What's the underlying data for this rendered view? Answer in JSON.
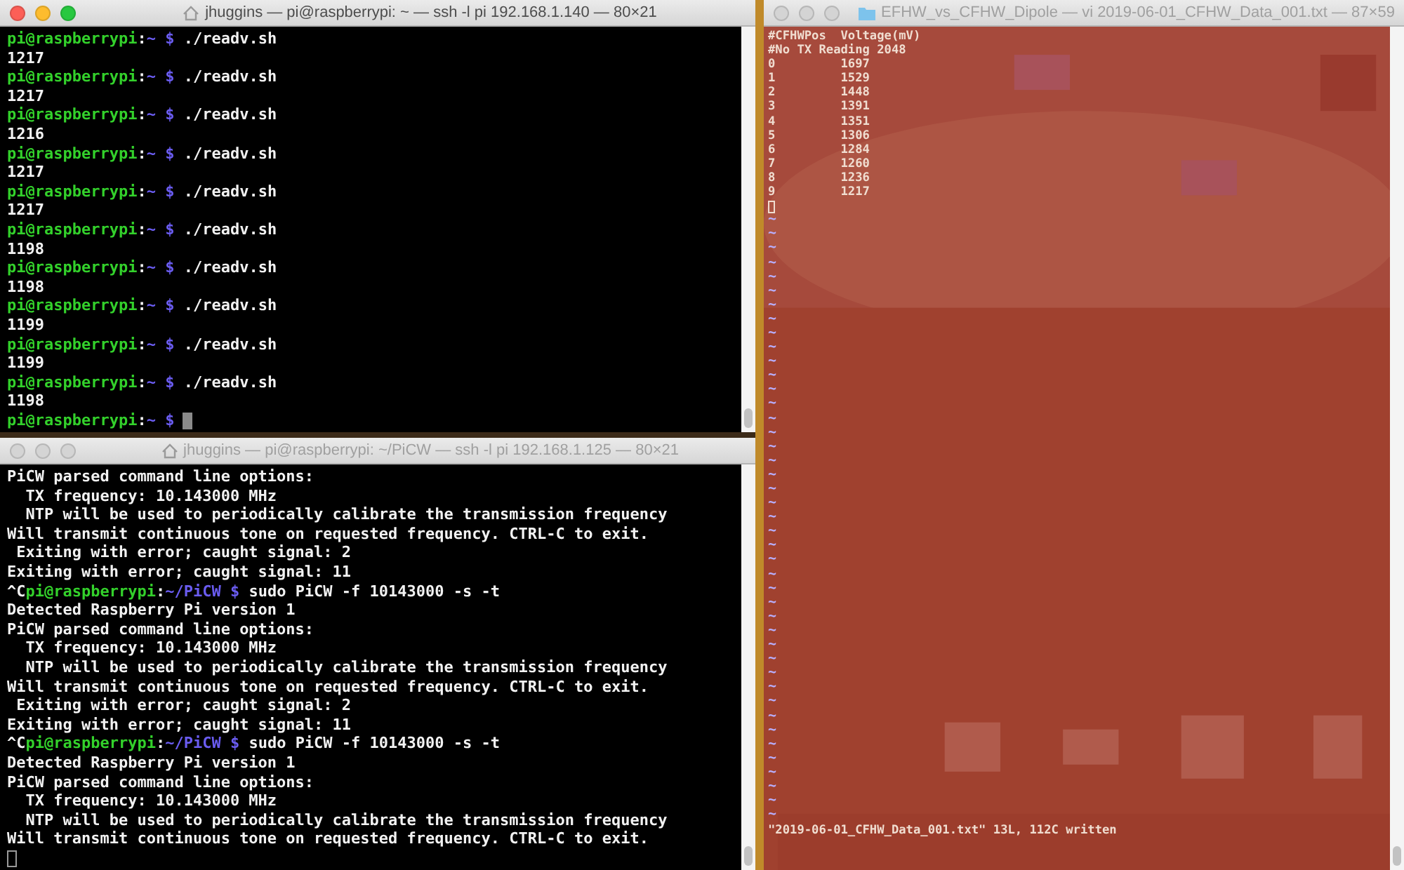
{
  "terminals": [
    {
      "title": "jhuggins — pi@raspberrypi: ~ — ssh -l pi 192.168.1.140 — 80×21",
      "active": true,
      "lines": [
        {
          "kind": "prompt",
          "user": "pi@raspberrypi",
          "sep": ":",
          "path": "~ $",
          "command": "./readv.sh"
        },
        {
          "kind": "output",
          "text": "1217"
        },
        {
          "kind": "prompt",
          "user": "pi@raspberrypi",
          "sep": ":",
          "path": "~ $",
          "command": "./readv.sh"
        },
        {
          "kind": "output",
          "text": "1217"
        },
        {
          "kind": "prompt",
          "user": "pi@raspberrypi",
          "sep": ":",
          "path": "~ $",
          "command": "./readv.sh"
        },
        {
          "kind": "output",
          "text": "1216"
        },
        {
          "kind": "prompt",
          "user": "pi@raspberrypi",
          "sep": ":",
          "path": "~ $",
          "command": "./readv.sh"
        },
        {
          "kind": "output",
          "text": "1217"
        },
        {
          "kind": "prompt",
          "user": "pi@raspberrypi",
          "sep": ":",
          "path": "~ $",
          "command": "./readv.sh"
        },
        {
          "kind": "output",
          "text": "1217"
        },
        {
          "kind": "prompt",
          "user": "pi@raspberrypi",
          "sep": ":",
          "path": "~ $",
          "command": "./readv.sh"
        },
        {
          "kind": "output",
          "text": "1198"
        },
        {
          "kind": "prompt",
          "user": "pi@raspberrypi",
          "sep": ":",
          "path": "~ $",
          "command": "./readv.sh"
        },
        {
          "kind": "output",
          "text": "1198"
        },
        {
          "kind": "prompt",
          "user": "pi@raspberrypi",
          "sep": ":",
          "path": "~ $",
          "command": "./readv.sh"
        },
        {
          "kind": "output",
          "text": "1199"
        },
        {
          "kind": "prompt",
          "user": "pi@raspberrypi",
          "sep": ":",
          "path": "~ $",
          "command": "./readv.sh"
        },
        {
          "kind": "output",
          "text": "1199"
        },
        {
          "kind": "prompt",
          "user": "pi@raspberrypi",
          "sep": ":",
          "path": "~ $",
          "command": "./readv.sh"
        },
        {
          "kind": "output",
          "text": "1198"
        },
        {
          "kind": "prompt",
          "user": "pi@raspberrypi",
          "sep": ":",
          "path": "~ $",
          "cursor": true
        }
      ]
    },
    {
      "title": "jhuggins — pi@raspberrypi: ~/PiCW — ssh -l pi 192.168.1.125 — 80×21",
      "active": false,
      "lines": [
        {
          "kind": "output",
          "text": "PiCW parsed command line options:"
        },
        {
          "kind": "output",
          "text": "  TX frequency: 10.143000 MHz"
        },
        {
          "kind": "output",
          "text": "  NTP will be used to periodically calibrate the transmission frequency"
        },
        {
          "kind": "output",
          "text": "Will transmit continuous tone on requested frequency. CTRL-C to exit."
        },
        {
          "kind": "output",
          "text": " Exiting with error; caught signal: 2"
        },
        {
          "kind": "output",
          "text": "Exiting with error; caught signal: 11"
        },
        {
          "kind": "prompt",
          "prefix": "^C",
          "user": "pi@raspberrypi",
          "sep": ":",
          "path": "~/PiCW $",
          "command": "sudo PiCW -f 10143000 -s -t"
        },
        {
          "kind": "output",
          "text": "Detected Raspberry Pi version 1"
        },
        {
          "kind": "output",
          "text": "PiCW parsed command line options:"
        },
        {
          "kind": "output",
          "text": "  TX frequency: 10.143000 MHz"
        },
        {
          "kind": "output",
          "text": "  NTP will be used to periodically calibrate the transmission frequency"
        },
        {
          "kind": "output",
          "text": "Will transmit continuous tone on requested frequency. CTRL-C to exit."
        },
        {
          "kind": "output",
          "text": " Exiting with error; caught signal: 2"
        },
        {
          "kind": "output",
          "text": "Exiting with error; caught signal: 11"
        },
        {
          "kind": "prompt",
          "prefix": "^C",
          "user": "pi@raspberrypi",
          "sep": ":",
          "path": "~/PiCW $",
          "command": "sudo PiCW -f 10143000 -s -t"
        },
        {
          "kind": "output",
          "text": "Detected Raspberry Pi version 1"
        },
        {
          "kind": "output",
          "text": "PiCW parsed command line options:"
        },
        {
          "kind": "output",
          "text": "  TX frequency: 10.143000 MHz"
        },
        {
          "kind": "output",
          "text": "  NTP will be used to periodically calibrate the transmission frequency"
        },
        {
          "kind": "output",
          "text": "Will transmit continuous tone on requested frequency. CTRL-C to exit."
        },
        {
          "kind": "cursor"
        }
      ]
    }
  ],
  "editor": {
    "title": "EFHW_vs_CFHW_Dipole — vi 2019-06-01_CFHW_Data_001.txt — 87×59",
    "active": false,
    "lines": [
      "#CFHWPos  Voltage(mV)",
      "#No TX Reading 2048",
      "0         1697",
      "1         1529",
      "2         1448",
      "3         1391",
      "4         1351",
      "5         1306",
      "6         1284",
      "7         1260",
      "8         1236",
      "9         1217"
    ],
    "empty_line_markers": [
      "~",
      "~",
      "~",
      "~",
      "~",
      "~",
      "~",
      "~",
      "~",
      "~",
      "~",
      "~",
      "~",
      "~",
      "~",
      "~",
      "~",
      "~",
      "~",
      "~",
      "~",
      "~",
      "~",
      "~",
      "~",
      "~",
      "~",
      "~",
      "~",
      "~",
      "~",
      "~",
      "~",
      "~",
      "~",
      "~",
      "~",
      "~",
      "~",
      "~",
      "~",
      "~",
      "~"
    ],
    "status": "\"2019-06-01_CFHW_Data_001.txt\" 13L, 112C written"
  }
}
